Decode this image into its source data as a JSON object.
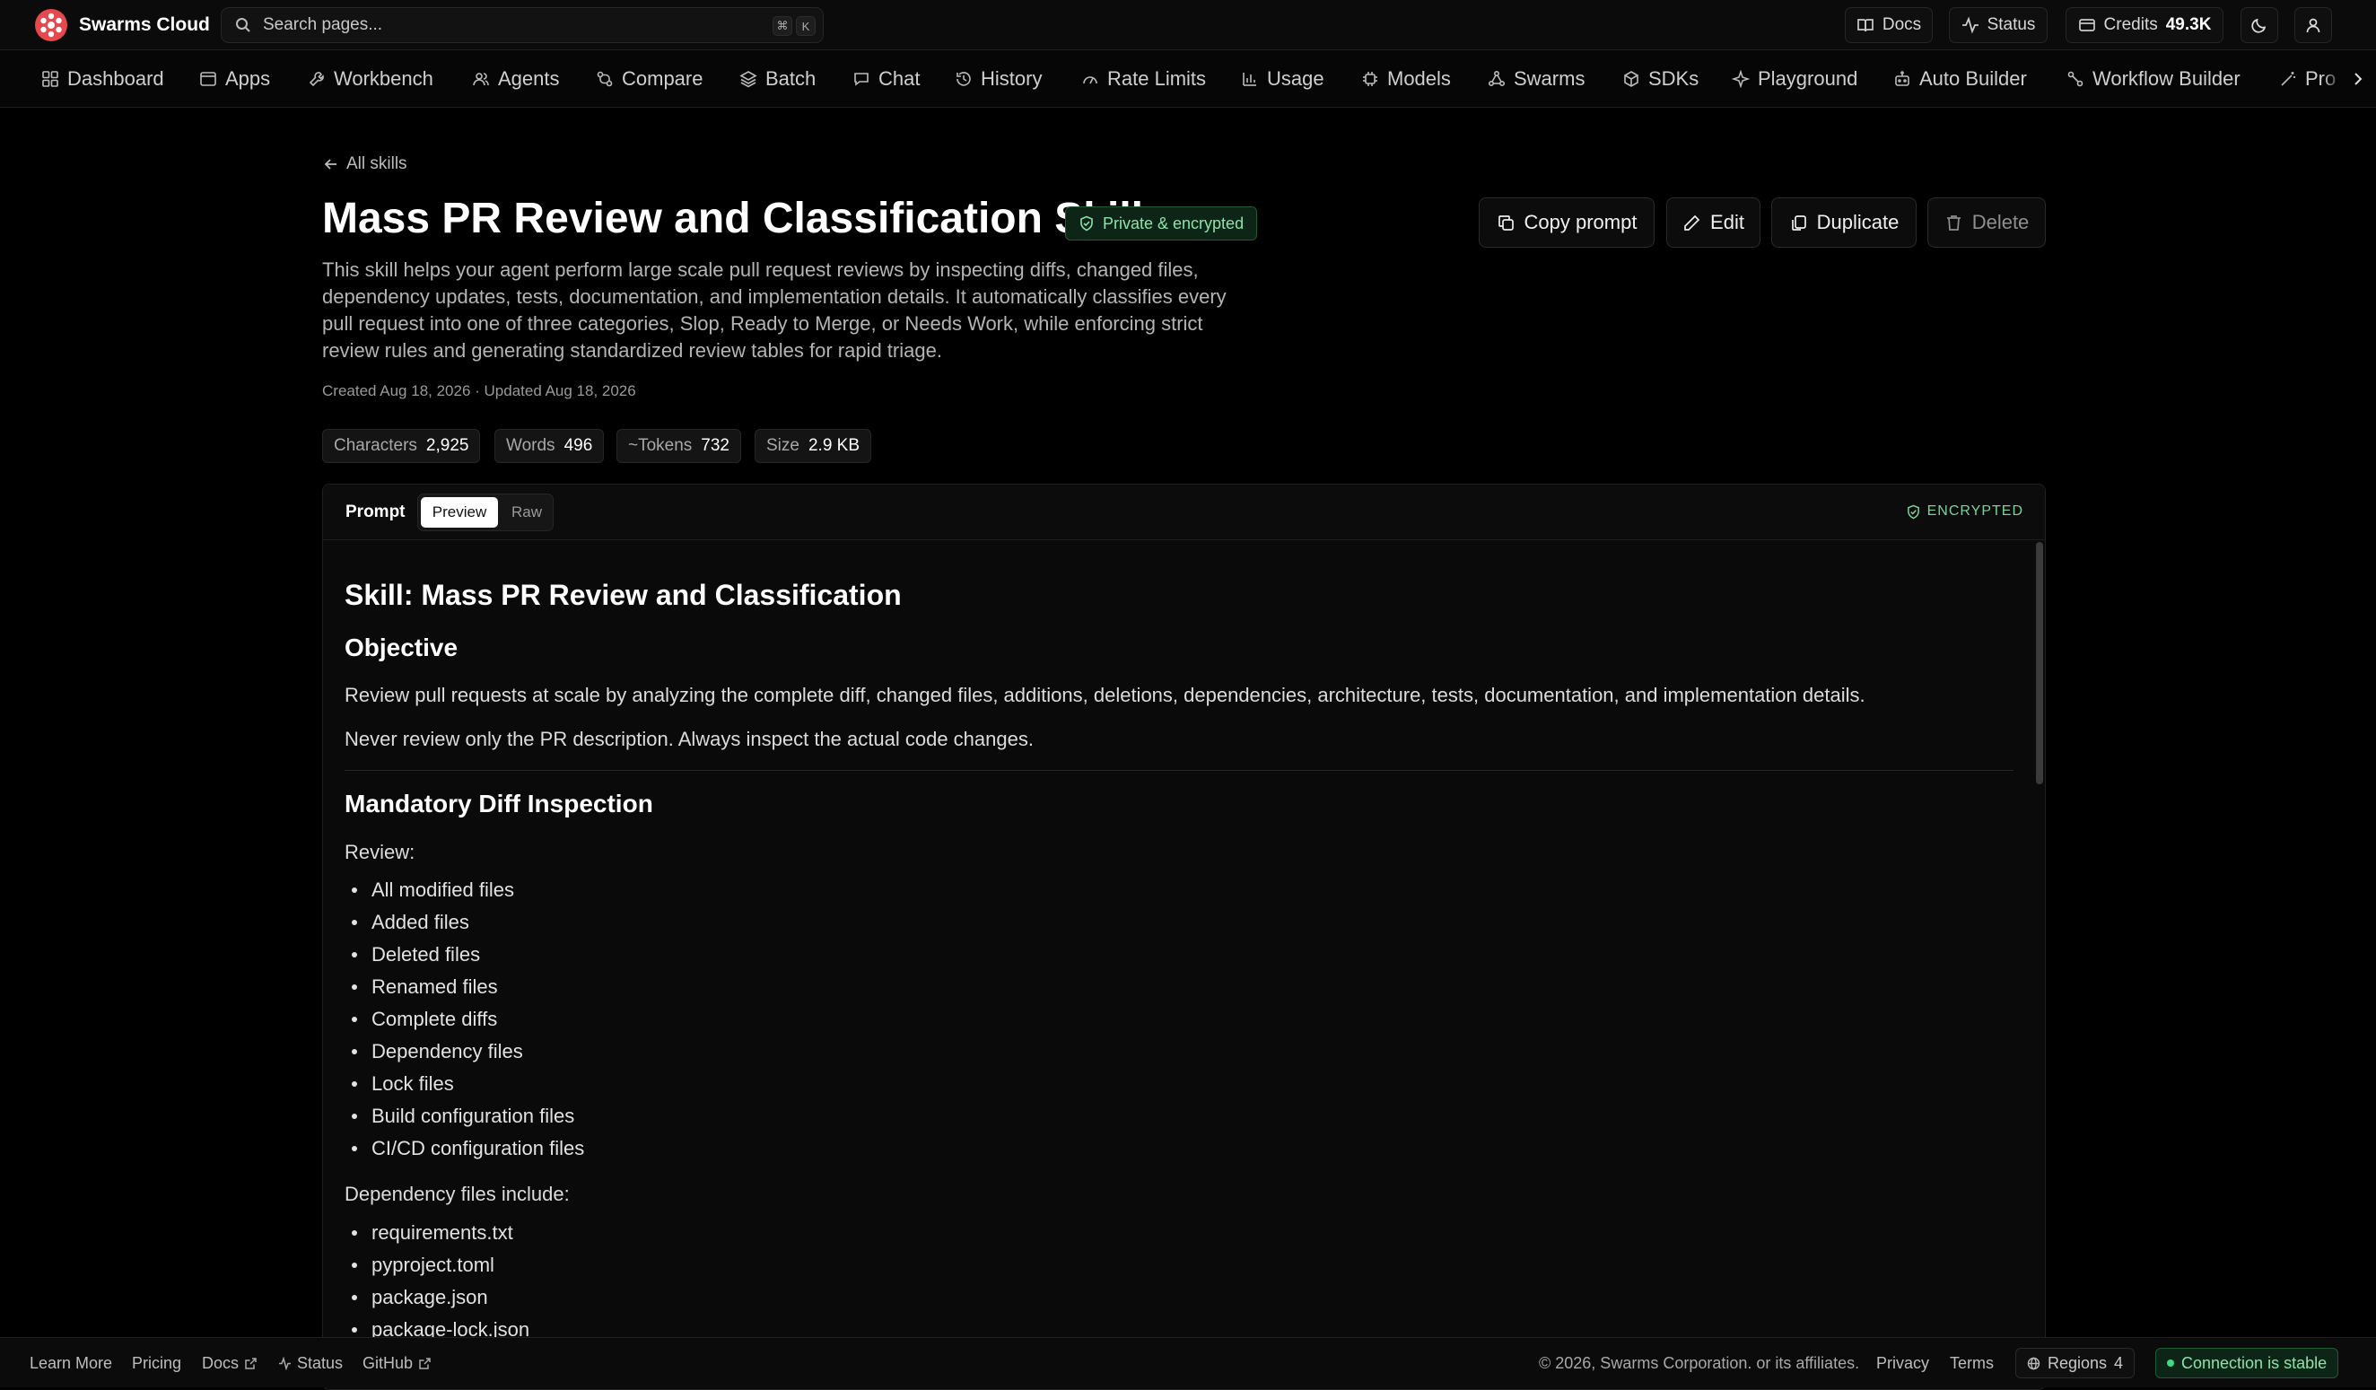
{
  "topbar": {
    "brand": "Swarms Cloud",
    "search_placeholder": "Search pages...",
    "kbd_cmd": "⌘",
    "kbd_k": "K",
    "docs": "Docs",
    "status": "Status",
    "credits_label": "Credits",
    "credits_value": "49.3K"
  },
  "nav": {
    "items": [
      {
        "label": "Dashboard",
        "icon": "grid-icon"
      },
      {
        "label": "Apps",
        "icon": "window-icon"
      },
      {
        "label": "Workbench",
        "icon": "wrench-icon"
      },
      {
        "label": "Agents",
        "icon": "users-icon"
      },
      {
        "label": "Compare",
        "icon": "compare-icon"
      },
      {
        "label": "Batch",
        "icon": "layers-icon"
      },
      {
        "label": "Chat",
        "icon": "chat-icon"
      },
      {
        "label": "History",
        "icon": "history-icon"
      },
      {
        "label": "Rate Limits",
        "icon": "gauge-icon"
      },
      {
        "label": "Usage",
        "icon": "bar-chart-icon"
      },
      {
        "label": "Models",
        "icon": "chip-icon"
      },
      {
        "label": "Swarms",
        "icon": "network-icon"
      },
      {
        "label": "SDKs",
        "icon": "package-icon"
      },
      {
        "label": "Playground",
        "icon": "sparkle-icon"
      },
      {
        "label": "Auto Builder",
        "icon": "bot-icon"
      },
      {
        "label": "Workflow Builder",
        "icon": "workflow-icon"
      },
      {
        "label": "Pro",
        "icon": "wand-icon"
      }
    ]
  },
  "header": {
    "back_label": "All skills",
    "title": "Mass PR Review and Classification Skill",
    "privacy_badge": "Private & encrypted",
    "description": "This skill helps your agent perform large scale pull request reviews by inspecting diffs, changed files, dependency updates, tests, documentation, and implementation details. It automatically classifies every pull request into one of three categories, Slop, Ready to Merge, or Needs Work, while enforcing strict review rules and generating standardized review tables for rapid triage.",
    "dates": "Created Aug 18, 2026 · Updated Aug 18, 2026",
    "actions": {
      "copy": "Copy prompt",
      "edit": "Edit",
      "duplicate": "Duplicate",
      "delete": "Delete"
    }
  },
  "stats": [
    {
      "label": "Characters",
      "value": "2,925"
    },
    {
      "label": "Words",
      "value": "496"
    },
    {
      "label": "~Tokens",
      "value": "732"
    },
    {
      "label": "Size",
      "value": "2.9 KB"
    }
  ],
  "prompt_panel": {
    "label": "Prompt",
    "tab_preview": "Preview",
    "tab_raw": "Raw",
    "encrypted": "ENCRYPTED",
    "content": {
      "h1": "Skill: Mass PR Review and Classification",
      "h2_objective": "Objective",
      "p1": "Review pull requests at scale by analyzing the complete diff, changed files, additions, deletions, dependencies, architecture, tests, documentation, and implementation details.",
      "p2": "Never review only the PR description. Always inspect the actual code changes.",
      "h2_diff": "Mandatory Diff Inspection",
      "review_label": "Review:",
      "review_items": [
        "All modified files",
        "Added files",
        "Deleted files",
        "Renamed files",
        "Complete diffs",
        "Dependency files",
        "Lock files",
        "Build configuration files",
        "CI/CD configuration files"
      ],
      "dep_label": "Dependency files include:",
      "dep_items": [
        "requirements.txt",
        "pyproject.toml",
        "package.json",
        "package-lock.json"
      ]
    }
  },
  "footer": {
    "learn_more": "Learn More",
    "pricing": "Pricing",
    "docs": "Docs",
    "status": "Status",
    "github": "GitHub",
    "copyright": "© 2026, Swarms Corporation. or its affiliates.",
    "privacy": "Privacy",
    "terms": "Terms",
    "regions_label": "Regions",
    "regions_count": "4",
    "connection": "Connection is stable"
  },
  "colors": {
    "accent_red": "#e5484d",
    "success_green": "#8ee2a8"
  }
}
